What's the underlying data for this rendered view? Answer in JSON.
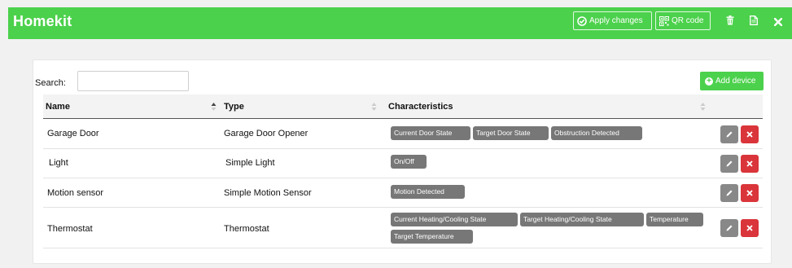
{
  "header": {
    "title": "Homekit",
    "apply_label": "Apply changes",
    "qr_label": "QR code"
  },
  "toolbar": {
    "search_label": "Search:",
    "search_value": "",
    "add_label": "Add device"
  },
  "table": {
    "columns": [
      "Name",
      "Type",
      "Characteristics"
    ],
    "rows": [
      {
        "name": "Garage Door",
        "type": "Garage Door Opener",
        "characteristics": [
          "Current Door State",
          "Target Door State",
          "Obstruction Detected"
        ]
      },
      {
        "name": "Light",
        "type": "Simple Light",
        "characteristics": [
          "On/Off"
        ]
      },
      {
        "name": "Motion sensor",
        "type": "Simple Motion Sensor",
        "characteristics": [
          "Motion Detected"
        ]
      },
      {
        "name": "Thermostat",
        "type": "Thermostat",
        "characteristics": [
          "Current Heating/Cooling State",
          "Target Heating/Cooling State",
          "Temperature",
          "Target Temperature"
        ]
      }
    ]
  },
  "colors": {
    "accent": "#4cd14c",
    "tag": "#777777",
    "edit": "#888888",
    "delete": "#d9353a"
  },
  "icons": [
    "check-circle-icon",
    "qr-code-icon",
    "trash-icon",
    "file-icon",
    "close-icon",
    "plus-circle-icon",
    "sort-icon",
    "pencil-icon",
    "x-icon"
  ]
}
